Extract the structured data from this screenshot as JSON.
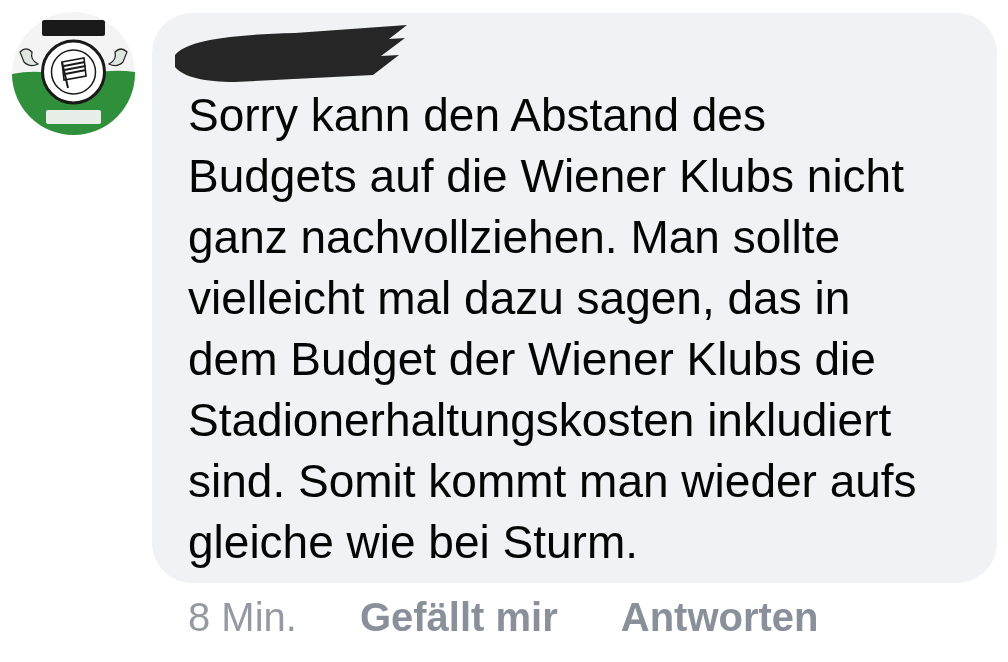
{
  "comment": {
    "text": "Sorry kann den Abstand des\nBudgets auf die Wiener Klubs nicht\nganz nachvollziehen. Man sollte\nvielleicht mal dazu sagen, das in\ndem Budget der Wiener Klubs die\nStadionerhaltungskosten inkludiert\nsind. Somit kommt man wieder aufs\ngleiche wie bei Sturm.",
    "time": "8 Min.",
    "actions": [
      "Gefällt mir",
      "Antworten"
    ]
  }
}
